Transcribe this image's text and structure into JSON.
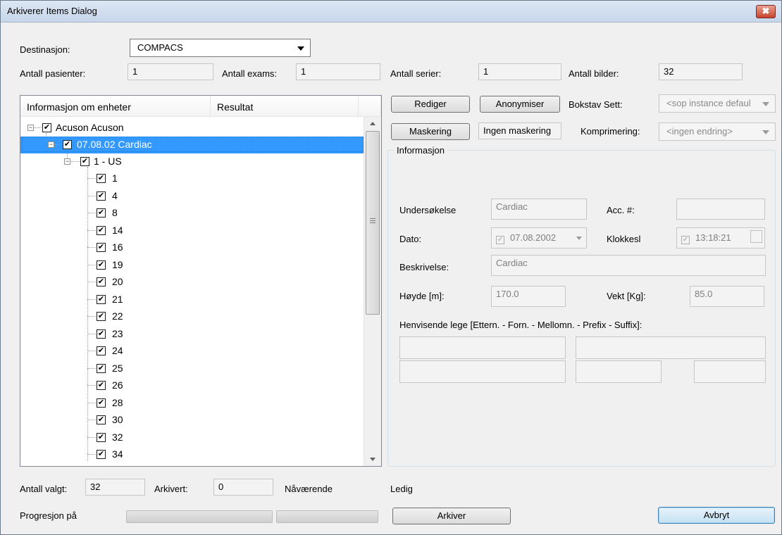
{
  "window": {
    "title": "Arkiverer Items Dialog",
    "close_glyph": "✖"
  },
  "destination": {
    "label": "Destinasjon:",
    "value": "COMPACS"
  },
  "counts": {
    "patients_label": "Antall pasienter:",
    "patients_value": "1",
    "exams_label": "Antall exams:",
    "exams_value": "1",
    "series_label": "Antall serier:",
    "series_value": "1",
    "images_label": "Antall bilder:",
    "images_value": "32"
  },
  "tree": {
    "headers": [
      "Informasjon om enheter",
      "Resultat"
    ],
    "root": "Acuson Acuson",
    "study": "07.08.02 Cardiac",
    "series": "1 - US",
    "images": [
      "1",
      "4",
      "8",
      "14",
      "16",
      "19",
      "20",
      "21",
      "22",
      "23",
      "24",
      "25",
      "26",
      "28",
      "30",
      "32",
      "34"
    ],
    "check_glyph": "✔"
  },
  "actions": {
    "edit_label": "Rediger",
    "anonymize_label": "Anonymiser",
    "masking_label": "Maskering",
    "masking_status": "Ingen maskering",
    "charset_label": "Bokstav Sett:",
    "charset_value": "<sop instance defaul",
    "compression_label": "Komprimering:",
    "compression_value": "<ingen endring>"
  },
  "info": {
    "group_label": "Informasjon",
    "exam_label": "Undersøkelse",
    "exam_value": "Cardiac",
    "acc_label": "Acc. #:",
    "acc_value": "",
    "date_label": "Dato:",
    "date_value": "07.08.2002",
    "time_label": "Klokkesl",
    "time_value": "13:18:21",
    "desc_label": "Beskrivelse:",
    "desc_value": "Cardiac",
    "height_label": "Høyde [m]:",
    "height_value": "170.0",
    "weight_label": "Vekt [Kg]:",
    "weight_value": "85.0",
    "referring_label": "Henvisende lege [Ettern. - Forn. - Mellomn. - Prefix - Suffix]:",
    "referring_values": [
      "",
      "",
      "",
      "",
      ""
    ]
  },
  "footer": {
    "selected_label": "Antall valgt:",
    "selected_value": "32",
    "archived_label": "Arkivert:",
    "archived_value": "0",
    "current_label": "Nåværende",
    "status_label": "Ledig",
    "progress_label": "Progresjon på",
    "progress_1": 0,
    "progress_2": 0,
    "archive_label": "Arkiver",
    "cancel_label": "Avbryt"
  }
}
